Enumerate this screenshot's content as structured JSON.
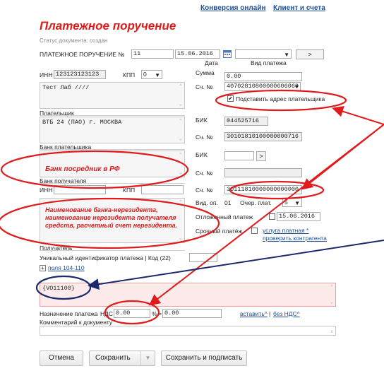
{
  "nav": {
    "conversion": "Конверсия онлайн",
    "clients": "Клиент и счета"
  },
  "header": {
    "title": "Платежное поручение",
    "status": "Статус документа: создан"
  },
  "doc": {
    "label": "ПЛАТЕЖНОЕ ПОРУЧЕНИЕ №",
    "number": "11",
    "date": "15.06.2016",
    "arrow_btn": ">"
  },
  "cols": {
    "date": "Дата",
    "payment_type": "Вид платежа"
  },
  "payer": {
    "inn_label": "ИНН",
    "inn": "123123123123",
    "kpp_label": "КПП",
    "kpp": "0",
    "name": "Тест Лаб ////",
    "amount_label": "Сумма",
    "amount": "0.00",
    "account_label": "Сч. №",
    "account": "40702810800000606060",
    "substitute_label": "Подставить адрес плательщика",
    "section_label": "Плательщик"
  },
  "payer_bank": {
    "name": "ВТБ 24 (ПАО) г. МОСКВА",
    "bik_label": "БИК",
    "bik": "044525716",
    "account_label": "Сч. №",
    "account": "30101810100000000716",
    "section_label": "Банк плательщика"
  },
  "recipient_bank": {
    "bik_label": "БИК",
    "account_label": "Сч. №",
    "section_label": "Банк получателя",
    "arrow_btn": ">"
  },
  "recipient": {
    "inn_label": "ИНН",
    "kpp_label": "КПП",
    "account_label": "Сч. №",
    "account": "30111810000000000000",
    "op_type_label": "Вид. оп.",
    "op_type": "01",
    "priority_label": "Очер. плат.",
    "priority": "5",
    "deferred_label": "Отложенный платеж",
    "deferred_date": "15.06.2016",
    "urgent_label": "Срочный платёж",
    "paid_service": "услуга платная *",
    "check_counterparty": "проверить контрагента",
    "section_label": "Получатель"
  },
  "uip": {
    "label": "Уникальный идентификатор платежа | Код (22)",
    "fields_link": "поля 104-110"
  },
  "purpose": {
    "text": "{VO11100}",
    "label": "Назначение платежа",
    "vat_label": "НДС",
    "vat_rate": "0.00",
    "percent": "%",
    "equals": "=",
    "vat_amount": "0.00",
    "insert_link": "вставить^",
    "separator": "|",
    "no_vat_link": "без НДС^"
  },
  "comment": {
    "label": "Комментарий к документу"
  },
  "buttons": {
    "cancel": "Отмена",
    "save": "Сохранить",
    "save_sign": "Сохранить и подписать"
  },
  "annotations": {
    "intermediary": "Банк посредник в РФ",
    "nonresident": "Наименование банка-нерезидента, наименование нерезидента получателя средств, расчетный счет нерезидента."
  },
  "colors": {
    "accent_red": "#e01b1b",
    "link_blue": "#1d4f9a",
    "annotation_navy": "#1a2a6c",
    "purpose_bg": "#fdeaea"
  },
  "icons": {
    "calendar": "calendar-icon",
    "dropdown": "chevron-down-icon",
    "expand": "plus-box-icon"
  }
}
